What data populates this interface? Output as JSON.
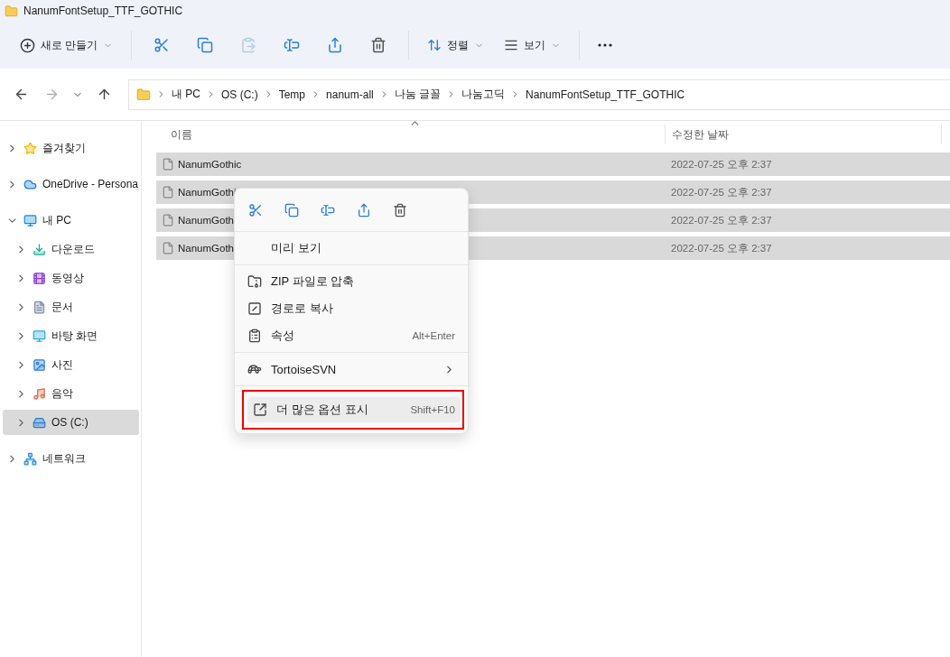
{
  "window": {
    "title": "NanumFontSetup_TTF_GOTHIC"
  },
  "toolbar": {
    "new_button": "새로 만들기",
    "actions": [
      {
        "kind": "cut",
        "disabled": false
      },
      {
        "kind": "copy",
        "disabled": false
      },
      {
        "kind": "paste",
        "disabled": true
      },
      {
        "kind": "rename",
        "disabled": false
      },
      {
        "kind": "share",
        "disabled": false
      },
      {
        "kind": "delete",
        "disabled": false
      }
    ],
    "sort_button": "정렬",
    "view_button": "보기"
  },
  "navigation": {
    "forward_disabled": true
  },
  "breadcrumb": [
    "내 PC",
    "OS (C:)",
    "Temp",
    "nanum-all",
    "나눔 글꼴",
    "나눔고딕",
    "NanumFontSetup_TTF_GOTHIC"
  ],
  "sidebar": {
    "items": [
      {
        "label": "즐겨찾기",
        "kind": "star",
        "expanded": false,
        "selected": false
      },
      {
        "label": "OneDrive - Persona",
        "kind": "cloud",
        "expanded": false,
        "selected": false
      },
      {
        "label": "내 PC",
        "kind": "pc",
        "expanded": true,
        "selected": false,
        "children": [
          {
            "label": "다운로드",
            "kind": "download",
            "expanded": false,
            "selected": false
          },
          {
            "label": "동영상",
            "kind": "video",
            "expanded": false,
            "selected": false
          },
          {
            "label": "문서",
            "kind": "document",
            "expanded": false,
            "selected": false
          },
          {
            "label": "바탕 화면",
            "kind": "desktop",
            "expanded": false,
            "selected": false
          },
          {
            "label": "사진",
            "kind": "picture",
            "expanded": false,
            "selected": false
          },
          {
            "label": "음악",
            "kind": "music",
            "expanded": false,
            "selected": false
          },
          {
            "label": "OS (C:)",
            "kind": "drive",
            "expanded": false,
            "selected": true
          }
        ]
      },
      {
        "label": "네트워크",
        "kind": "network",
        "expanded": false,
        "selected": false
      }
    ]
  },
  "table": {
    "columns": [
      "이름",
      "수정한 날짜"
    ],
    "rows": [
      {
        "name": "NanumGothic",
        "modified": "2022-07-25 오후 2:37",
        "selected": true
      },
      {
        "name": "NanumGothi",
        "modified": "2022-07-25 오후 2:37",
        "selected": true
      },
      {
        "name": "NanumGoth",
        "modified": "2022-07-25 오후 2:37",
        "selected": true
      },
      {
        "name": "NanumGoth",
        "modified": "2022-07-25 오후 2:37",
        "selected": true
      }
    ]
  },
  "context_menu": {
    "actions": [
      {
        "kind": "cut"
      },
      {
        "kind": "copy"
      },
      {
        "kind": "rename"
      },
      {
        "kind": "share"
      },
      {
        "kind": "delete"
      }
    ],
    "groups": [
      [
        {
          "kind": "plain",
          "label": "미리 보기",
          "highlighted": false
        }
      ],
      [
        {
          "kind": "zip",
          "label": "ZIP 파일로 압축",
          "highlighted": false
        },
        {
          "kind": "path",
          "label": "경로로 복사",
          "highlighted": false
        },
        {
          "kind": "properties",
          "label": "속성",
          "shortcut": "Alt+Enter",
          "highlighted": false
        }
      ],
      [
        {
          "kind": "svn",
          "label": "TortoiseSVN",
          "submenu": true,
          "highlighted": false
        }
      ],
      [
        {
          "kind": "more",
          "label": "더 많은 옵션 표시",
          "shortcut": "Shift+F10",
          "highlighted": true
        }
      ]
    ]
  }
}
